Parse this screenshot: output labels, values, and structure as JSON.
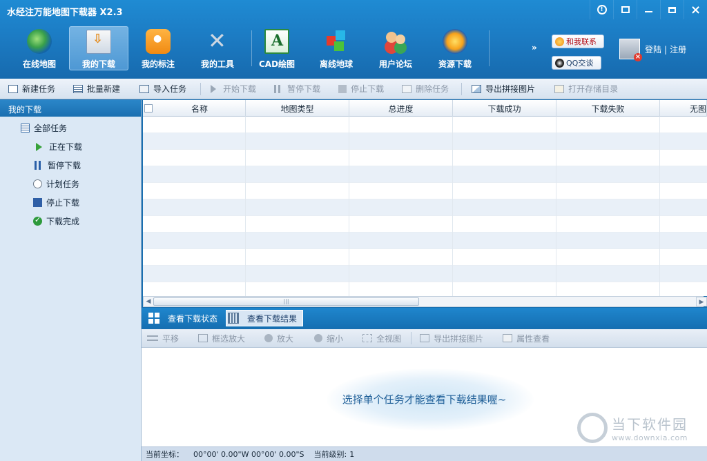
{
  "app": {
    "title": "水经注万能地图下载器 X2.3"
  },
  "main_tabs": [
    {
      "label": "在线地图",
      "icon": "globe-icon"
    },
    {
      "label": "我的下载",
      "icon": "download-icon",
      "active": true
    },
    {
      "label": "我的标注",
      "icon": "pin-icon"
    },
    {
      "label": "我的工具",
      "icon": "tools-icon"
    },
    {
      "label": "CAD绘图",
      "icon": "cad-icon"
    },
    {
      "label": "离线地球",
      "icon": "cube-icon"
    },
    {
      "label": "用户论坛",
      "icon": "users-icon"
    },
    {
      "label": "资源下载",
      "icon": "resource-icon"
    }
  ],
  "more": "»",
  "contact": {
    "label": "和我联系",
    "qq": "QQ交谈"
  },
  "account": {
    "login": "登陆",
    "separator": "|",
    "register": "注册"
  },
  "actions": [
    {
      "label": "新建任务",
      "enabled": true
    },
    {
      "label": "批量新建",
      "enabled": true
    },
    {
      "label": "导入任务",
      "enabled": true
    },
    {
      "label": "开始下载",
      "enabled": false
    },
    {
      "label": "暂停下载",
      "enabled": false
    },
    {
      "label": "停止下载",
      "enabled": false
    },
    {
      "label": "删除任务",
      "enabled": false
    },
    {
      "label": "导出拼接图片",
      "enabled": true
    },
    {
      "label": "打开存储目录",
      "enabled": false
    }
  ],
  "sidebar": {
    "title": "我的下载",
    "items": [
      {
        "label": "全部任务",
        "icon": "list-icon"
      },
      {
        "label": "正在下载",
        "icon": "play-icon"
      },
      {
        "label": "暂停下载",
        "icon": "pause-icon"
      },
      {
        "label": "计划任务",
        "icon": "clock-icon"
      },
      {
        "label": "停止下载",
        "icon": "stop-icon"
      },
      {
        "label": "下载完成",
        "icon": "check-icon"
      }
    ]
  },
  "table": {
    "columns": [
      "名称",
      "地图类型",
      "总进度",
      "下载成功",
      "下载失败",
      "无图"
    ],
    "rows": []
  },
  "bottom_tabs": [
    {
      "label": "查看下载状态",
      "icon": "grid-icon"
    },
    {
      "label": "查看下载结果",
      "icon": "dots-icon",
      "active": true
    }
  ],
  "map_tools": [
    {
      "label": "平移"
    },
    {
      "label": "框选放大"
    },
    {
      "label": "放大"
    },
    {
      "label": "缩小"
    },
    {
      "label": "全视图"
    },
    {
      "label": "导出拼接图片"
    },
    {
      "label": "属性查看"
    }
  ],
  "preview": {
    "hint": "选择单个任务才能查看下载结果喔~"
  },
  "watermark": {
    "title": "当下软件园",
    "url": "www.downxia.com"
  },
  "status": {
    "coord_label": "当前坐标：",
    "coord_value": "00°00' 0.00\"W 00°00' 0.00\"S",
    "level_label": "当前级别:",
    "level_value": "1"
  }
}
